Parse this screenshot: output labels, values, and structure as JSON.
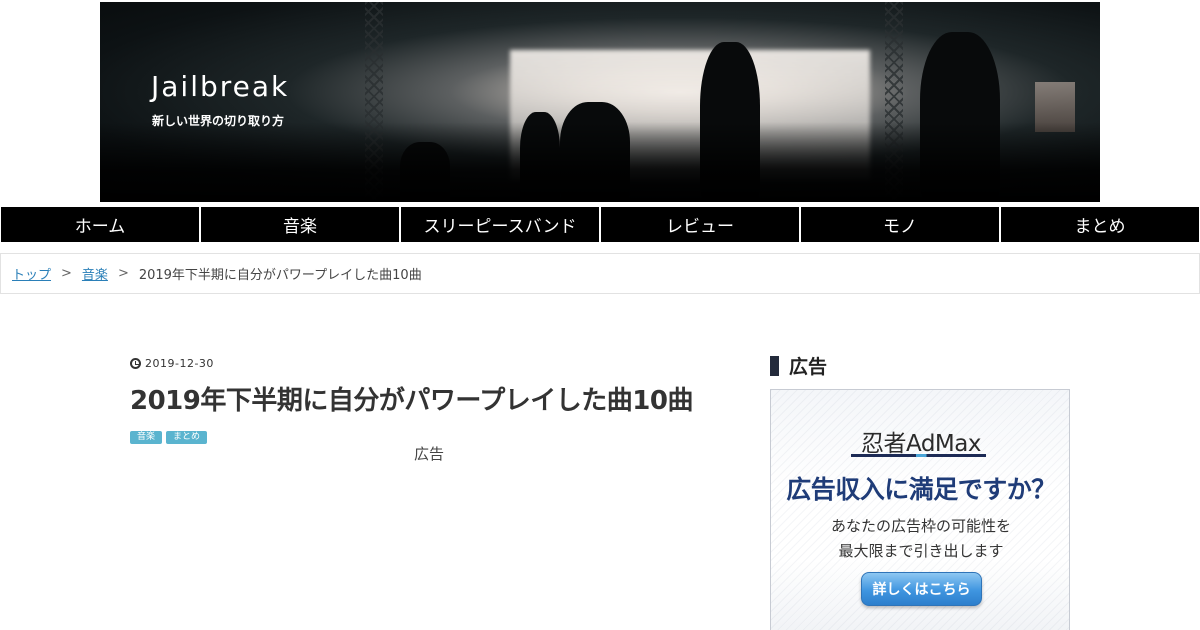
{
  "site": {
    "title": "Jailbreak",
    "tagline": "新しい世界の切り取り方"
  },
  "nav": {
    "items": [
      {
        "label": "ホーム"
      },
      {
        "label": "音楽"
      },
      {
        "label": "スリーピースバンド"
      },
      {
        "label": "レビュー"
      },
      {
        "label": "モノ"
      },
      {
        "label": "まとめ"
      }
    ]
  },
  "breadcrumb": {
    "top": "トップ",
    "category": "音楽",
    "current": "2019年下半期に自分がパワープレイした曲10曲",
    "separator": ">"
  },
  "post": {
    "date": "2019-12-30",
    "title": "2019年下半期に自分がパワープレイした曲10曲",
    "tags": [
      "音楽",
      "まとめ"
    ],
    "ad_label": "広告"
  },
  "sidebar": {
    "heading": "広告",
    "ad": {
      "logo": "忍者AdMax",
      "headline": "広告収入に満足ですか？",
      "body_line1": "あなたの広告枠の可能性を",
      "body_line2": "最大限まで引き出します",
      "button": "詳しくはこちら"
    }
  },
  "colors": {
    "nav_bg": "#000000",
    "link": "#2a7fb8",
    "tag_bg": "#5ab4cf",
    "ad_headline": "#1f3c78",
    "ad_button": "#3f95e0"
  }
}
